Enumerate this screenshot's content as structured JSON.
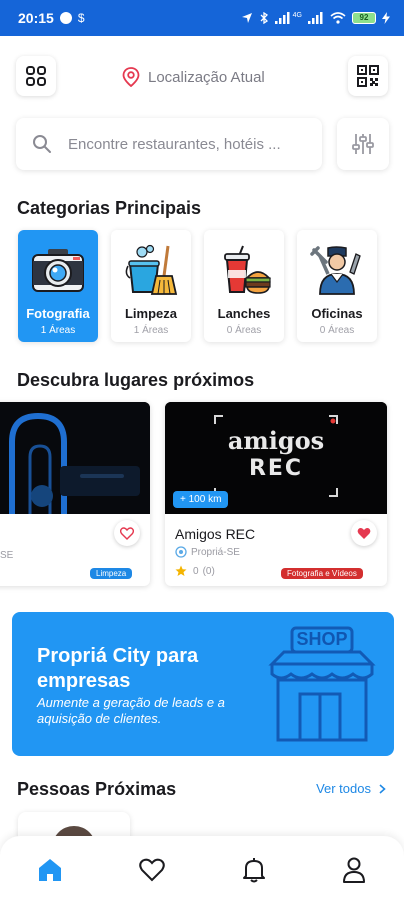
{
  "status": {
    "time": "20:15",
    "battery": "92",
    "network": "4G"
  },
  "header": {
    "location_label": "Localização Atual"
  },
  "search": {
    "placeholder": "Encontre restaurantes, hotéis ..."
  },
  "categories": {
    "title": "Categorias Principais",
    "items": [
      {
        "name": "Fotografia",
        "count": "1 Áreas",
        "active": true
      },
      {
        "name": "Limpeza",
        "count": "1 Áreas",
        "active": false
      },
      {
        "name": "Lanches",
        "count": "0 Áreas",
        "active": false
      },
      {
        "name": "Oficinas",
        "count": "0 Áreas",
        "active": false
      }
    ]
  },
  "places": {
    "title": "Descubra lugares próximos",
    "items": [
      {
        "name": "",
        "location": "SE",
        "tag": "Limpeza",
        "tag_color": "#1e88e5",
        "favorite": false
      },
      {
        "name": "Amigos REC",
        "location": "Propriá-SE",
        "rating": "0",
        "reviews": "(0)",
        "distance": "+ 100 km",
        "tag": "Fotografia e Vídeos",
        "tag_color": "#d32f2f",
        "favorite": true,
        "logo_line1": "amigos",
        "logo_line2": "REC"
      }
    ]
  },
  "promo": {
    "title": "Propriá City para empresas",
    "subtitle": "Aumente a geração de leads e a aquisição de clientes.",
    "shop_sign": "SHOP"
  },
  "people": {
    "title": "Pessoas Próximas",
    "see_all": "Ver todos"
  },
  "colors": {
    "primary": "#2196f3",
    "statusbar": "#1565d8",
    "heart": "#e53950",
    "tag_red": "#d32f2f"
  }
}
